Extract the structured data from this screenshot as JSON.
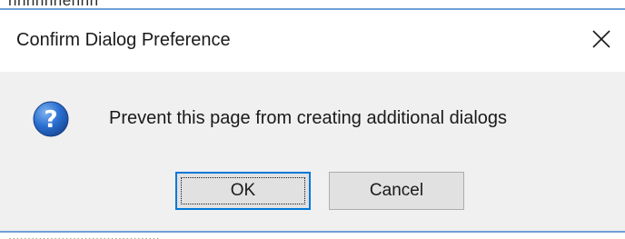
{
  "background_page": {
    "top_text": "nnnnnnennn",
    "bottom_text": "........................................"
  },
  "dialog": {
    "title": "Confirm Dialog Preference",
    "close_icon": "close-icon",
    "question_icon": "question-icon",
    "message": "Prevent this page from creating additional dialogs",
    "buttons": {
      "ok_label": "OK",
      "cancel_label": "Cancel"
    },
    "colors": {
      "accent": "#0078d7",
      "icon_blue": "#1f5fb8",
      "body_bg": "#f0f0f0"
    }
  }
}
